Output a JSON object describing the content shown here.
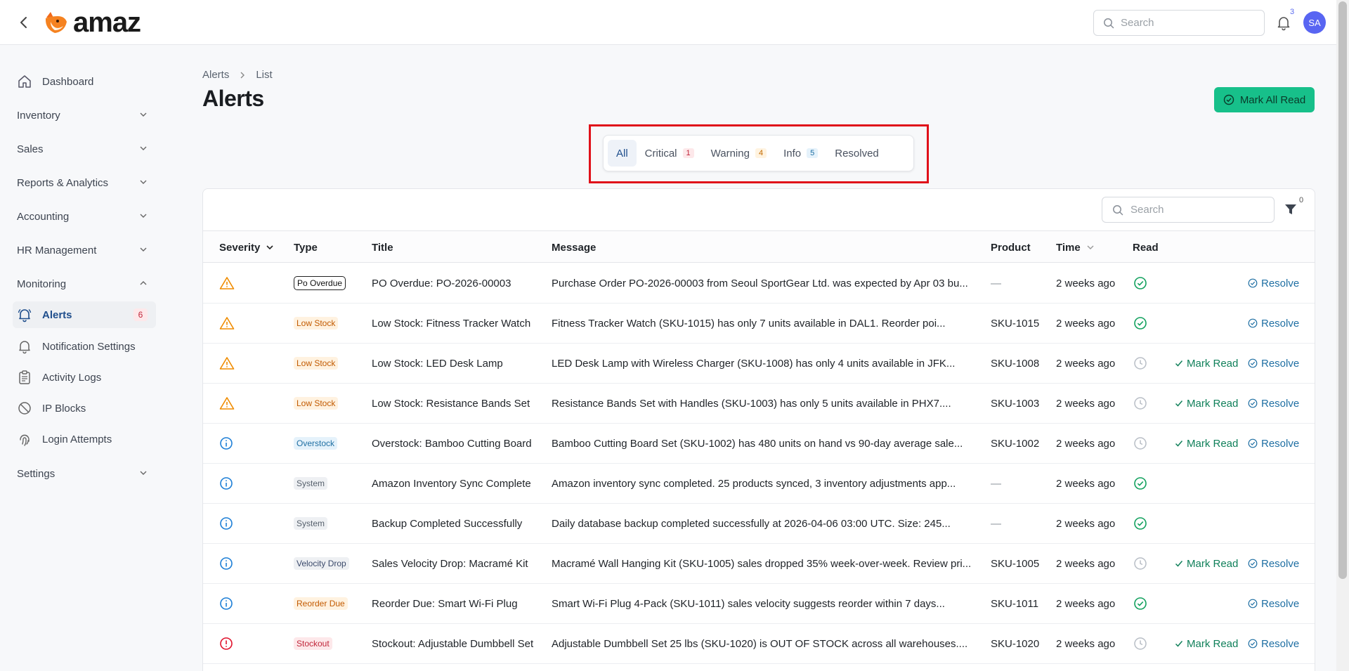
{
  "app": {
    "logo_text": "amaz"
  },
  "topbar": {
    "search_placeholder": "Search",
    "notifications_count": "3",
    "avatar_initials": "SA"
  },
  "sidebar": {
    "items": [
      {
        "label": "Dashboard",
        "icon": "home-icon"
      },
      {
        "label": "Inventory"
      },
      {
        "label": "Sales"
      },
      {
        "label": "Reports & Analytics"
      },
      {
        "label": "Accounting"
      },
      {
        "label": "HR Management"
      },
      {
        "label": "Monitoring"
      },
      {
        "label": "Alerts",
        "icon": "bell-icon",
        "badge": "6"
      },
      {
        "label": "Notification Settings",
        "icon": "bell-icon"
      },
      {
        "label": "Activity Logs",
        "icon": "clipboard-icon"
      },
      {
        "label": "IP Blocks",
        "icon": "ban-icon"
      },
      {
        "label": "Login Attempts",
        "icon": "fingerprint-icon"
      },
      {
        "label": "Settings"
      }
    ]
  },
  "breadcrumb": {
    "root": "Alerts",
    "current": "List"
  },
  "page": {
    "title": "Alerts",
    "mark_all_label": "Mark All Read"
  },
  "tabs": [
    {
      "label": "All"
    },
    {
      "label": "Critical",
      "count": "1"
    },
    {
      "label": "Warning",
      "count": "4"
    },
    {
      "label": "Info",
      "count": "5"
    },
    {
      "label": "Resolved"
    }
  ],
  "table": {
    "search_placeholder": "Search",
    "filter_count": "0",
    "columns": {
      "severity": "Severity",
      "type": "Type",
      "title": "Title",
      "message": "Message",
      "product": "Product",
      "time": "Time",
      "read": "Read"
    },
    "action_labels": {
      "mark_read": "Mark Read",
      "resolve": "Resolve"
    },
    "colors": {
      "warning": "#f08c00",
      "info": "#1c7ed6",
      "critical": "#e0112b",
      "read_check": "#12a15e",
      "unread_clock": "#b8bec6"
    },
    "rows": [
      {
        "severity": "warning",
        "type": "Po Overdue",
        "type_style": "po",
        "title": "PO Overdue: PO-2026-00003",
        "message": "Purchase Order PO-2026-00003 from Seoul SportGear Ltd. was expected by Apr 03 bu...",
        "product": "—",
        "time": "2 weeks ago",
        "read": true,
        "mark_read": false,
        "resolve": true
      },
      {
        "severity": "warning",
        "type": "Low Stock",
        "type_style": "low",
        "title": "Low Stock: Fitness Tracker Watch",
        "message": "Fitness Tracker Watch (SKU-1015) has only 7 units available in DAL1. Reorder poi...",
        "product": "SKU-1015",
        "time": "2 weeks ago",
        "read": true,
        "mark_read": false,
        "resolve": true
      },
      {
        "severity": "warning",
        "type": "Low Stock",
        "type_style": "low",
        "title": "Low Stock: LED Desk Lamp",
        "message": "LED Desk Lamp with Wireless Charger (SKU-1008) has only 4 units available in JFK...",
        "product": "SKU-1008",
        "time": "2 weeks ago",
        "read": false,
        "mark_read": true,
        "resolve": true
      },
      {
        "severity": "warning",
        "type": "Low Stock",
        "type_style": "low",
        "title": "Low Stock: Resistance Bands Set",
        "message": "Resistance Bands Set with Handles (SKU-1003) has only 5 units available in PHX7....",
        "product": "SKU-1003",
        "time": "2 weeks ago",
        "read": false,
        "mark_read": true,
        "resolve": true
      },
      {
        "severity": "info",
        "type": "Overstock",
        "type_style": "over",
        "title": "Overstock: Bamboo Cutting Board",
        "message": "Bamboo Cutting Board Set (SKU-1002) has 480 units on hand vs 90-day average sale...",
        "product": "SKU-1002",
        "time": "2 weeks ago",
        "read": false,
        "mark_read": true,
        "resolve": true
      },
      {
        "severity": "info",
        "type": "System",
        "type_style": "sys",
        "title": "Amazon Inventory Sync Complete",
        "message": "Amazon inventory sync completed. 25 products synced, 3 inventory adjustments app...",
        "product": "—",
        "time": "2 weeks ago",
        "read": true,
        "mark_read": false,
        "resolve": false
      },
      {
        "severity": "info",
        "type": "System",
        "type_style": "sys",
        "title": "Backup Completed Successfully",
        "message": "Daily database backup completed successfully at 2026-04-06 03:00 UTC. Size: 245...",
        "product": "—",
        "time": "2 weeks ago",
        "read": true,
        "mark_read": false,
        "resolve": false
      },
      {
        "severity": "info",
        "type": "Velocity Drop",
        "type_style": "vel",
        "title": "Sales Velocity Drop: Macramé Kit",
        "message": "Macramé Wall Hanging Kit (SKU-1005) sales dropped 35% week-over-week. Review pri...",
        "product": "SKU-1005",
        "time": "2 weeks ago",
        "read": false,
        "mark_read": true,
        "resolve": true
      },
      {
        "severity": "info",
        "type": "Reorder Due",
        "type_style": "reo",
        "title": "Reorder Due: Smart Wi-Fi Plug",
        "message": "Smart Wi-Fi Plug 4-Pack (SKU-1011) sales velocity suggests reorder within 7 days...",
        "product": "SKU-1011",
        "time": "2 weeks ago",
        "read": true,
        "mark_read": false,
        "resolve": true
      },
      {
        "severity": "critical",
        "type": "Stockout",
        "type_style": "stock",
        "title": "Stockout: Adjustable Dumbbell Set",
        "message": "Adjustable Dumbbell Set 25 lbs (SKU-1020) is OUT OF STOCK across all warehouses....",
        "product": "SKU-1020",
        "time": "2 weeks ago",
        "read": false,
        "mark_read": true,
        "resolve": true
      }
    ]
  }
}
